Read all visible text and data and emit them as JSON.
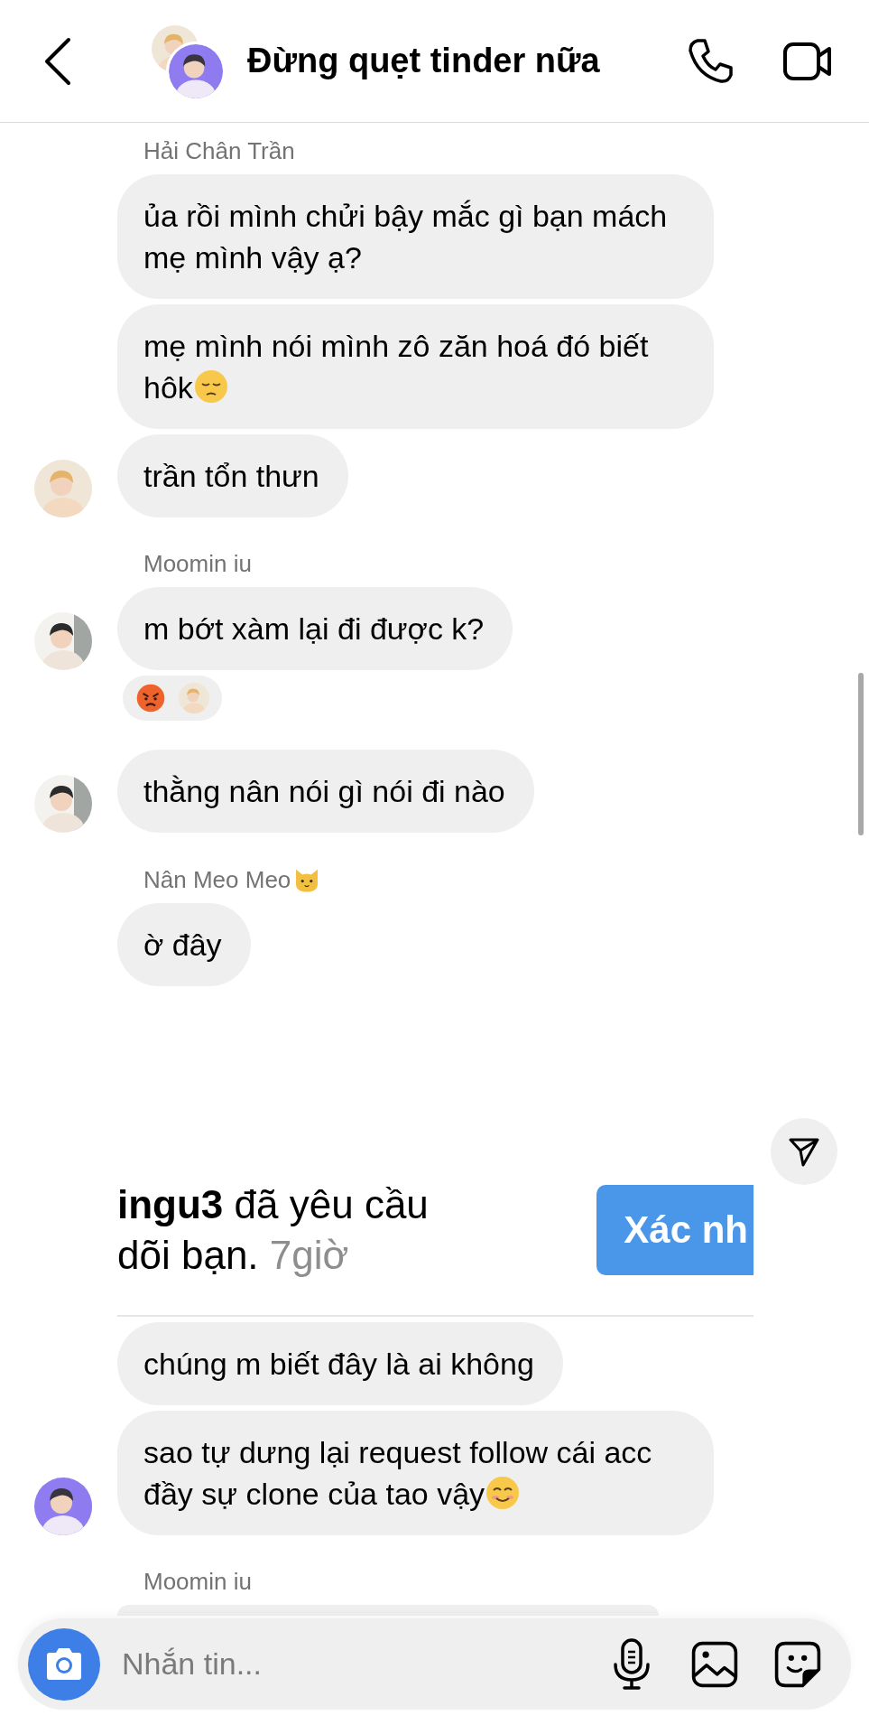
{
  "header": {
    "title": "Đừng quẹt tinder nữa"
  },
  "messages": [
    {
      "kind": "name",
      "text": "Hải Chân Trần"
    },
    {
      "kind": "bubble",
      "text": "ủa rồi mình chửi bậy mắc gì bạn mách mẹ mình vậy ạ?",
      "avatar": false
    },
    {
      "kind": "bubble",
      "text": "mẹ mình nói mình zô zăn hoá đó biết hôk",
      "emoji": {
        "kind": "pensive"
      },
      "avatar": false
    },
    {
      "kind": "bubble",
      "text": "trần tổn thưn",
      "avatar": true
    },
    {
      "kind": "name",
      "text": "Moomin iu"
    },
    {
      "kind": "bubble",
      "text": "m bớt xàm lại đi được k?",
      "avatar": true,
      "reactions": [
        {
          "kind": "angry"
        },
        {
          "kind": "avatar"
        }
      ]
    },
    {
      "kind": "bubble",
      "text": "thằng nân nói gì nói đi nào",
      "avatar": true
    },
    {
      "kind": "name",
      "text": "Nân Meo Meo",
      "emoji": {
        "kind": "cat"
      }
    },
    {
      "kind": "bubble",
      "text": "ờ đây",
      "avatar": false
    },
    {
      "kind": "shot",
      "line1_bold": "ingu3",
      "line1": "đã yêu cầu",
      "line2": "dõi bạn.",
      "time": "7giờ",
      "button": "Xác nh"
    },
    {
      "kind": "bubble",
      "text": "chúng m biết đây là ai không",
      "avatar": false
    },
    {
      "kind": "bubble",
      "text": "sao tự dưng lại request follow cái acc đầy sự clone của tao vậy",
      "emoji": {
        "kind": "smile"
      },
      "avatar": true
    },
    {
      "kind": "name",
      "text": "Moomin iu"
    },
    {
      "kind": "partial_bubble"
    }
  ],
  "composer": {
    "placeholder": "Nhắn tin..."
  }
}
